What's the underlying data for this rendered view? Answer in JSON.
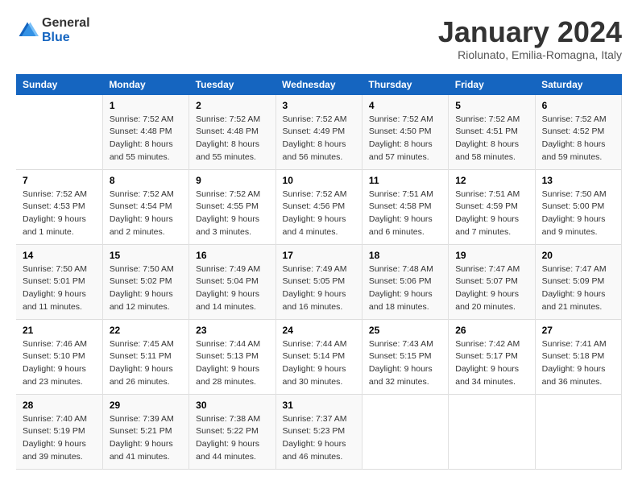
{
  "logo": {
    "general": "General",
    "blue": "Blue"
  },
  "title": "January 2024",
  "location": "Riolunato, Emilia-Romagna, Italy",
  "columns": [
    "Sunday",
    "Monday",
    "Tuesday",
    "Wednesday",
    "Thursday",
    "Friday",
    "Saturday"
  ],
  "weeks": [
    [
      {
        "day": "",
        "sunrise": "",
        "sunset": "",
        "daylight": ""
      },
      {
        "day": "1",
        "sunrise": "Sunrise: 7:52 AM",
        "sunset": "Sunset: 4:48 PM",
        "daylight": "Daylight: 8 hours and 55 minutes."
      },
      {
        "day": "2",
        "sunrise": "Sunrise: 7:52 AM",
        "sunset": "Sunset: 4:48 PM",
        "daylight": "Daylight: 8 hours and 55 minutes."
      },
      {
        "day": "3",
        "sunrise": "Sunrise: 7:52 AM",
        "sunset": "Sunset: 4:49 PM",
        "daylight": "Daylight: 8 hours and 56 minutes."
      },
      {
        "day": "4",
        "sunrise": "Sunrise: 7:52 AM",
        "sunset": "Sunset: 4:50 PM",
        "daylight": "Daylight: 8 hours and 57 minutes."
      },
      {
        "day": "5",
        "sunrise": "Sunrise: 7:52 AM",
        "sunset": "Sunset: 4:51 PM",
        "daylight": "Daylight: 8 hours and 58 minutes."
      },
      {
        "day": "6",
        "sunrise": "Sunrise: 7:52 AM",
        "sunset": "Sunset: 4:52 PM",
        "daylight": "Daylight: 8 hours and 59 minutes."
      }
    ],
    [
      {
        "day": "7",
        "sunrise": "Sunrise: 7:52 AM",
        "sunset": "Sunset: 4:53 PM",
        "daylight": "Daylight: 9 hours and 1 minute."
      },
      {
        "day": "8",
        "sunrise": "Sunrise: 7:52 AM",
        "sunset": "Sunset: 4:54 PM",
        "daylight": "Daylight: 9 hours and 2 minutes."
      },
      {
        "day": "9",
        "sunrise": "Sunrise: 7:52 AM",
        "sunset": "Sunset: 4:55 PM",
        "daylight": "Daylight: 9 hours and 3 minutes."
      },
      {
        "day": "10",
        "sunrise": "Sunrise: 7:52 AM",
        "sunset": "Sunset: 4:56 PM",
        "daylight": "Daylight: 9 hours and 4 minutes."
      },
      {
        "day": "11",
        "sunrise": "Sunrise: 7:51 AM",
        "sunset": "Sunset: 4:58 PM",
        "daylight": "Daylight: 9 hours and 6 minutes."
      },
      {
        "day": "12",
        "sunrise": "Sunrise: 7:51 AM",
        "sunset": "Sunset: 4:59 PM",
        "daylight": "Daylight: 9 hours and 7 minutes."
      },
      {
        "day": "13",
        "sunrise": "Sunrise: 7:50 AM",
        "sunset": "Sunset: 5:00 PM",
        "daylight": "Daylight: 9 hours and 9 minutes."
      }
    ],
    [
      {
        "day": "14",
        "sunrise": "Sunrise: 7:50 AM",
        "sunset": "Sunset: 5:01 PM",
        "daylight": "Daylight: 9 hours and 11 minutes."
      },
      {
        "day": "15",
        "sunrise": "Sunrise: 7:50 AM",
        "sunset": "Sunset: 5:02 PM",
        "daylight": "Daylight: 9 hours and 12 minutes."
      },
      {
        "day": "16",
        "sunrise": "Sunrise: 7:49 AM",
        "sunset": "Sunset: 5:04 PM",
        "daylight": "Daylight: 9 hours and 14 minutes."
      },
      {
        "day": "17",
        "sunrise": "Sunrise: 7:49 AM",
        "sunset": "Sunset: 5:05 PM",
        "daylight": "Daylight: 9 hours and 16 minutes."
      },
      {
        "day": "18",
        "sunrise": "Sunrise: 7:48 AM",
        "sunset": "Sunset: 5:06 PM",
        "daylight": "Daylight: 9 hours and 18 minutes."
      },
      {
        "day": "19",
        "sunrise": "Sunrise: 7:47 AM",
        "sunset": "Sunset: 5:07 PM",
        "daylight": "Daylight: 9 hours and 20 minutes."
      },
      {
        "day": "20",
        "sunrise": "Sunrise: 7:47 AM",
        "sunset": "Sunset: 5:09 PM",
        "daylight": "Daylight: 9 hours and 21 minutes."
      }
    ],
    [
      {
        "day": "21",
        "sunrise": "Sunrise: 7:46 AM",
        "sunset": "Sunset: 5:10 PM",
        "daylight": "Daylight: 9 hours and 23 minutes."
      },
      {
        "day": "22",
        "sunrise": "Sunrise: 7:45 AM",
        "sunset": "Sunset: 5:11 PM",
        "daylight": "Daylight: 9 hours and 26 minutes."
      },
      {
        "day": "23",
        "sunrise": "Sunrise: 7:44 AM",
        "sunset": "Sunset: 5:13 PM",
        "daylight": "Daylight: 9 hours and 28 minutes."
      },
      {
        "day": "24",
        "sunrise": "Sunrise: 7:44 AM",
        "sunset": "Sunset: 5:14 PM",
        "daylight": "Daylight: 9 hours and 30 minutes."
      },
      {
        "day": "25",
        "sunrise": "Sunrise: 7:43 AM",
        "sunset": "Sunset: 5:15 PM",
        "daylight": "Daylight: 9 hours and 32 minutes."
      },
      {
        "day": "26",
        "sunrise": "Sunrise: 7:42 AM",
        "sunset": "Sunset: 5:17 PM",
        "daylight": "Daylight: 9 hours and 34 minutes."
      },
      {
        "day": "27",
        "sunrise": "Sunrise: 7:41 AM",
        "sunset": "Sunset: 5:18 PM",
        "daylight": "Daylight: 9 hours and 36 minutes."
      }
    ],
    [
      {
        "day": "28",
        "sunrise": "Sunrise: 7:40 AM",
        "sunset": "Sunset: 5:19 PM",
        "daylight": "Daylight: 9 hours and 39 minutes."
      },
      {
        "day": "29",
        "sunrise": "Sunrise: 7:39 AM",
        "sunset": "Sunset: 5:21 PM",
        "daylight": "Daylight: 9 hours and 41 minutes."
      },
      {
        "day": "30",
        "sunrise": "Sunrise: 7:38 AM",
        "sunset": "Sunset: 5:22 PM",
        "daylight": "Daylight: 9 hours and 44 minutes."
      },
      {
        "day": "31",
        "sunrise": "Sunrise: 7:37 AM",
        "sunset": "Sunset: 5:23 PM",
        "daylight": "Daylight: 9 hours and 46 minutes."
      },
      {
        "day": "",
        "sunrise": "",
        "sunset": "",
        "daylight": ""
      },
      {
        "day": "",
        "sunrise": "",
        "sunset": "",
        "daylight": ""
      },
      {
        "day": "",
        "sunrise": "",
        "sunset": "",
        "daylight": ""
      }
    ]
  ]
}
